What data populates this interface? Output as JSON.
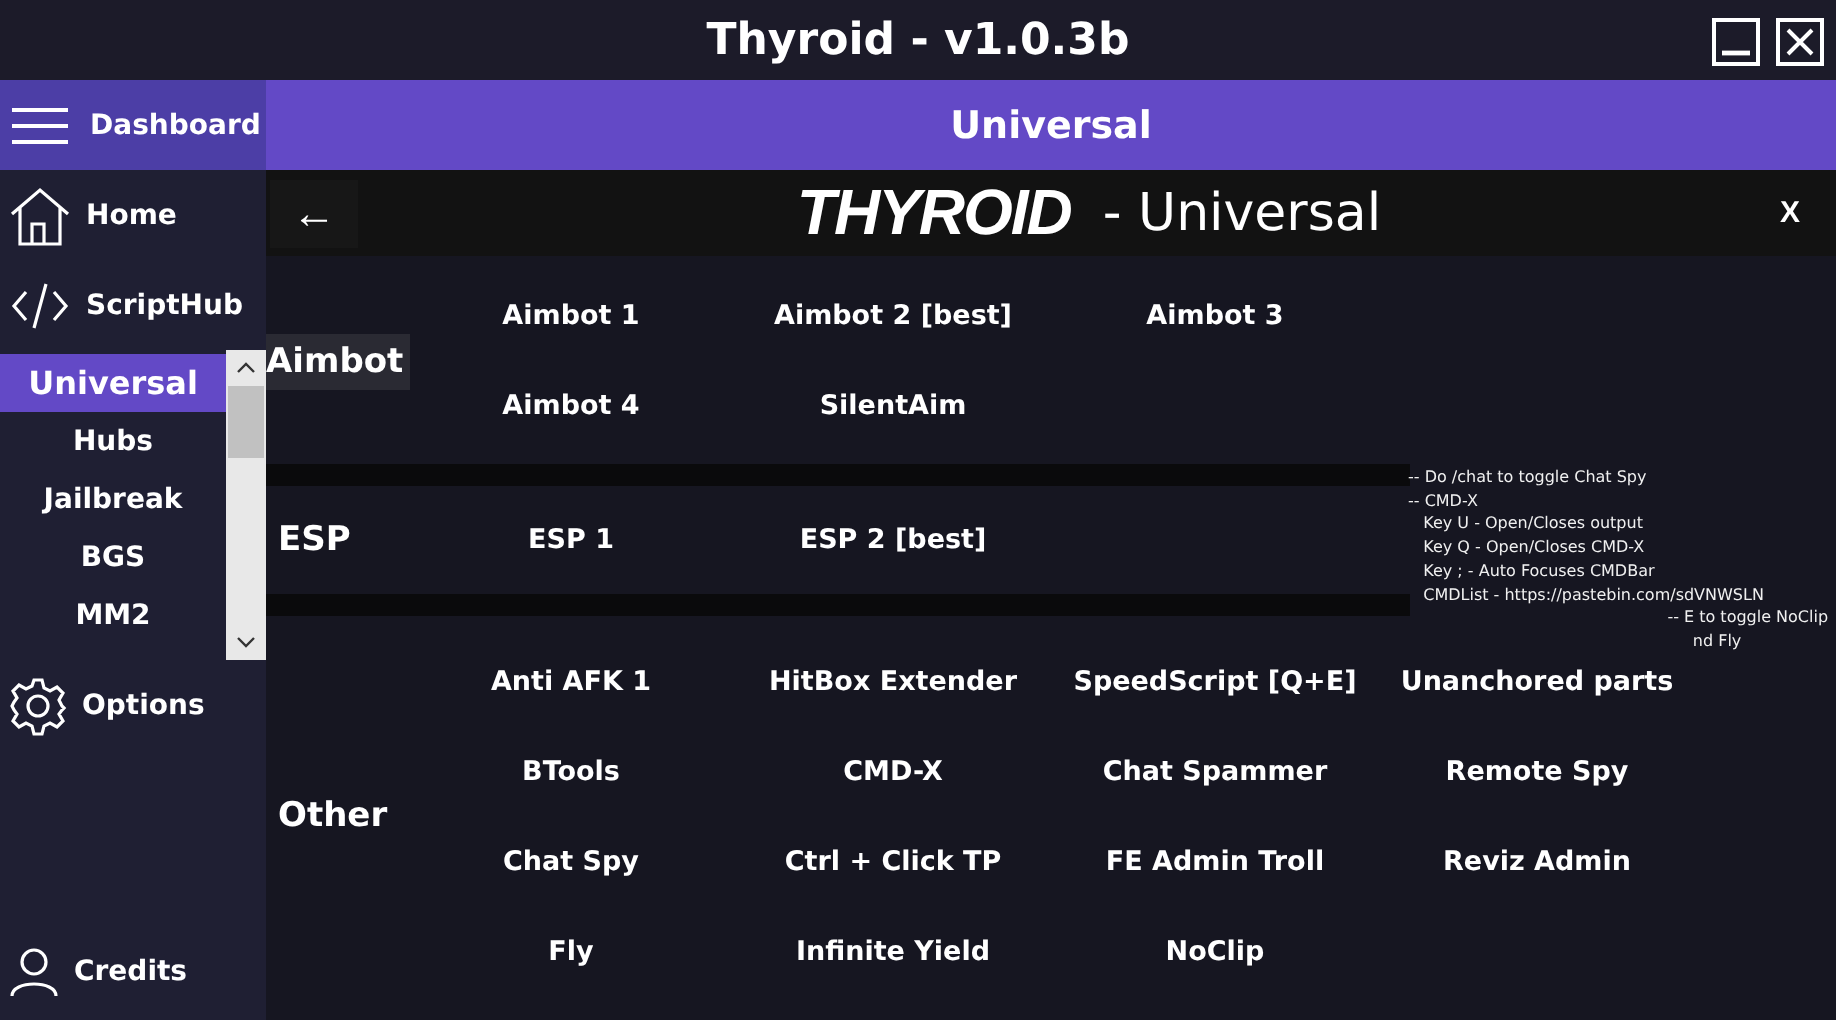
{
  "window": {
    "title": "Thyroid - v1.0.3b"
  },
  "sidebar": {
    "dashboard": "Dashboard",
    "nav": [
      {
        "kind": "home",
        "label": "Home"
      },
      {
        "kind": "code",
        "label": "ScriptHub"
      }
    ],
    "games": [
      {
        "label": "Universal",
        "selected": true
      },
      {
        "label": "Hubs",
        "selected": false
      },
      {
        "label": "Jailbreak",
        "selected": false
      },
      {
        "label": "BGS",
        "selected": false
      },
      {
        "label": "MM2",
        "selected": false
      }
    ],
    "bottom_nav": [
      {
        "kind": "gear",
        "label": "Options"
      },
      {
        "kind": "user",
        "label": "Credits"
      }
    ]
  },
  "header": {
    "title": "Universal"
  },
  "panel": {
    "back": "←",
    "logo": "THYROID",
    "title": "- Universal",
    "close": "X",
    "sections": [
      {
        "label": "Aimbot",
        "highlighted": true,
        "rows": [
          [
            "Aimbot 1",
            "Aimbot 2 [best]",
            "Aimbot 3"
          ],
          [
            "Aimbot 4",
            "SilentAim"
          ]
        ]
      },
      {
        "label": "ESP",
        "highlighted": false,
        "rows": [
          [
            "ESP 1",
            "ESP 2 [best]"
          ]
        ]
      },
      {
        "label": "Other",
        "highlighted": false,
        "rows": [
          [
            "Anti AFK 1",
            "HitBox Extender",
            "SpeedScript [Q+E]",
            "Unanchored parts"
          ],
          [
            "BTools",
            "CMD-X",
            "Chat Spammer",
            "Remote Spy"
          ],
          [
            "Chat Spy",
            "Ctrl + Click TP",
            "FE Admin Troll",
            "Reviz Admin"
          ],
          [
            "Fly",
            "Infinite Yield",
            "NoClip"
          ]
        ]
      }
    ],
    "notes": "-- Do /chat to toggle Chat Spy\n-- CMD-X\n   Key U - Open/Closes output\n   Key Q - Open/Closes CMD-X\n   Key ; - Auto Focuses CMDBar\n   CMDList - https://pastebin.com/sdVNWSLN\n                                                   -- E to toggle NoClip\n                                                        nd Fly"
  }
}
